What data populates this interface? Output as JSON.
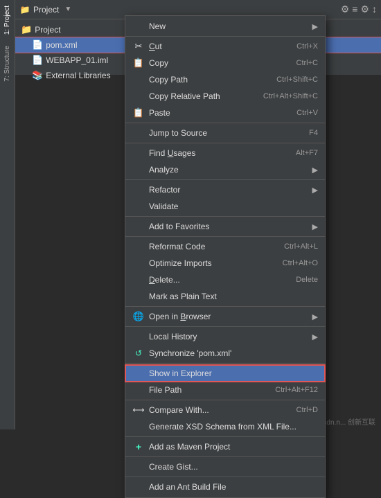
{
  "sidebar": {
    "tabs": [
      {
        "label": "1: Project",
        "active": true
      },
      {
        "label": "7: Structure",
        "active": false
      }
    ]
  },
  "topbar": {
    "title": "Project",
    "icons": [
      "⚙",
      "≡",
      "⚙",
      "↕"
    ]
  },
  "fileTree": {
    "items": [
      {
        "label": "Project",
        "icon": "📁",
        "indent": 0
      },
      {
        "label": "pom.xml",
        "icon": "📄",
        "indent": 1,
        "selected": true
      },
      {
        "label": "WEBAPP_01.iml",
        "icon": "📄",
        "indent": 1,
        "selected": false
      },
      {
        "label": "External Libraries",
        "icon": "📚",
        "indent": 1,
        "selected": false
      }
    ]
  },
  "contextMenu": {
    "items": [
      {
        "id": "new",
        "label": "New",
        "icon": "",
        "shortcut": "",
        "arrow": "▶",
        "separator_after": false
      },
      {
        "id": "sep1",
        "type": "separator"
      },
      {
        "id": "cut",
        "label": "Cut",
        "icon": "✂",
        "shortcut": "Ctrl+X",
        "separator_after": false
      },
      {
        "id": "copy",
        "label": "Copy",
        "icon": "📋",
        "shortcut": "Ctrl+C",
        "separator_after": false
      },
      {
        "id": "copypath",
        "label": "Copy Path",
        "icon": "",
        "shortcut": "Ctrl+Shift+C",
        "separator_after": false
      },
      {
        "id": "copyrelativepath",
        "label": "Copy Relative Path",
        "icon": "",
        "shortcut": "Ctrl+Alt+Shift+C",
        "separator_after": false
      },
      {
        "id": "paste",
        "label": "Paste",
        "icon": "📋",
        "shortcut": "Ctrl+V",
        "separator_after": false
      },
      {
        "id": "sep2",
        "type": "separator"
      },
      {
        "id": "jumptosource",
        "label": "Jump to Source",
        "icon": "",
        "shortcut": "F4",
        "separator_after": false
      },
      {
        "id": "sep3",
        "type": "separator"
      },
      {
        "id": "findusages",
        "label": "Find Usages",
        "icon": "",
        "shortcut": "Alt+F7",
        "separator_after": false
      },
      {
        "id": "analyze",
        "label": "Analyze",
        "icon": "",
        "shortcut": "",
        "arrow": "▶",
        "separator_after": false
      },
      {
        "id": "sep4",
        "type": "separator"
      },
      {
        "id": "refactor",
        "label": "Refactor",
        "icon": "",
        "shortcut": "",
        "arrow": "▶",
        "separator_after": false
      },
      {
        "id": "validate",
        "label": "Validate",
        "icon": "",
        "shortcut": "",
        "separator_after": false
      },
      {
        "id": "sep5",
        "type": "separator"
      },
      {
        "id": "addtofavorites",
        "label": "Add to Favorites",
        "icon": "",
        "shortcut": "",
        "arrow": "▶",
        "separator_after": false
      },
      {
        "id": "sep6",
        "type": "separator"
      },
      {
        "id": "reformatcode",
        "label": "Reformat Code",
        "icon": "",
        "shortcut": "Ctrl+Alt+L",
        "separator_after": false
      },
      {
        "id": "optimizeimports",
        "label": "Optimize Imports",
        "icon": "",
        "shortcut": "Ctrl+Alt+O",
        "separator_after": false
      },
      {
        "id": "delete",
        "label": "Delete...",
        "icon": "",
        "shortcut": "Delete",
        "separator_after": false
      },
      {
        "id": "markasp",
        "label": "Mark as Plain Text",
        "icon": "",
        "shortcut": "",
        "separator_after": false
      },
      {
        "id": "sep7",
        "type": "separator"
      },
      {
        "id": "openinbrowser",
        "label": "Open in Browser",
        "icon": "🌐",
        "shortcut": "",
        "arrow": "▶",
        "separator_after": false
      },
      {
        "id": "sep8",
        "type": "separator"
      },
      {
        "id": "localhistory",
        "label": "Local History",
        "icon": "",
        "shortcut": "",
        "arrow": "▶",
        "separator_after": false
      },
      {
        "id": "synchronize",
        "label": "Synchronize 'pom.xml'",
        "icon": "🔄",
        "shortcut": "",
        "separator_after": false
      },
      {
        "id": "sep9",
        "type": "separator"
      },
      {
        "id": "showinexplorer",
        "label": "Show in Explorer",
        "icon": "",
        "shortcut": "",
        "highlighted": true,
        "separator_after": false
      },
      {
        "id": "filepath",
        "label": "File Path",
        "icon": "",
        "shortcut": "Ctrl+Alt+F12",
        "separator_after": false
      },
      {
        "id": "sep10",
        "type": "separator"
      },
      {
        "id": "comparewith",
        "label": "Compare With...",
        "icon": "⟷",
        "shortcut": "Ctrl+D",
        "separator_after": false
      },
      {
        "id": "generatexsd",
        "label": "Generate XSD Schema from XML File...",
        "icon": "",
        "shortcut": "",
        "separator_after": false
      },
      {
        "id": "sep11",
        "type": "separator"
      },
      {
        "id": "addasmaven",
        "label": "Add as Maven Project",
        "icon": "+",
        "shortcut": "",
        "separator_after": false
      },
      {
        "id": "sep12",
        "type": "separator"
      },
      {
        "id": "creategist",
        "label": "Create Gist...",
        "icon": "",
        "shortcut": "",
        "separator_after": false
      },
      {
        "id": "sep13",
        "type": "separator"
      },
      {
        "id": "addantbuildfile",
        "label": "Add an Ant Build File",
        "icon": "",
        "shortcut": "",
        "separator_after": false
      }
    ]
  }
}
